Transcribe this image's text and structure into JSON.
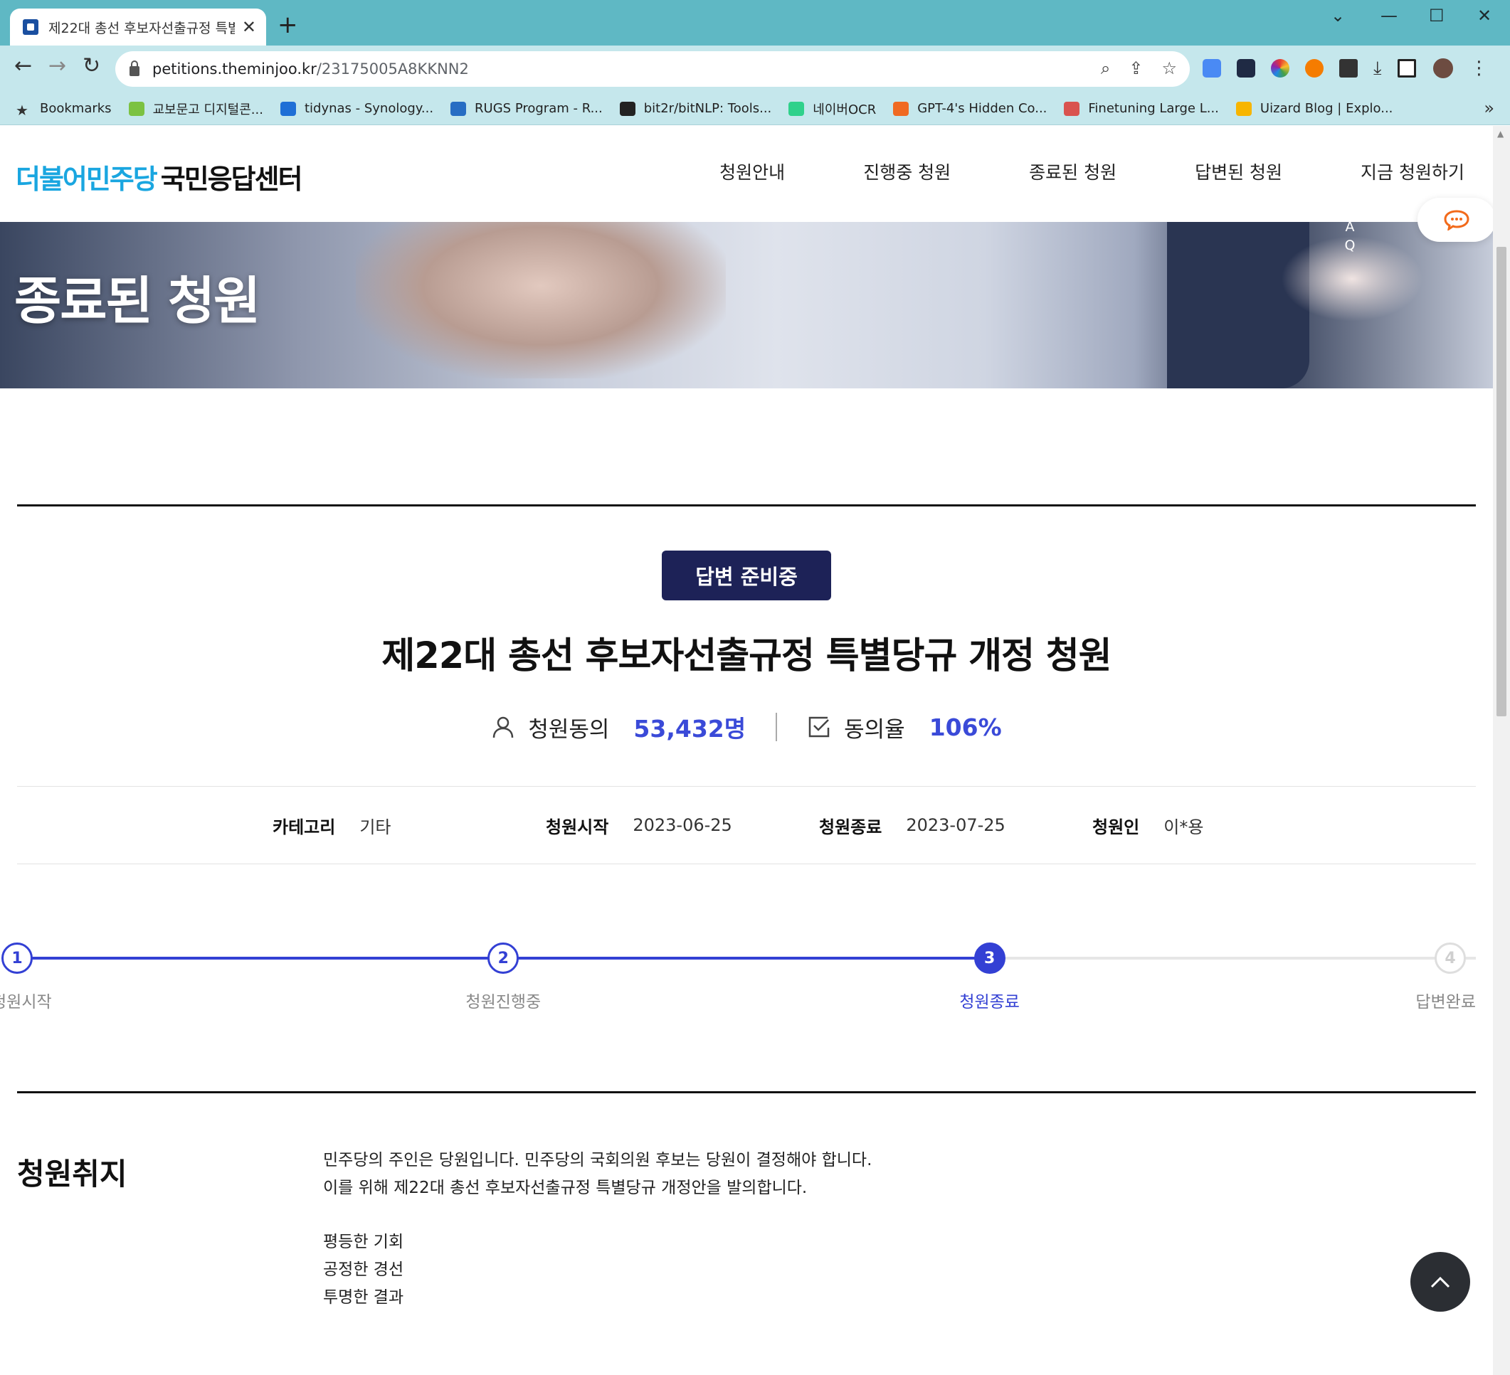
{
  "browser": {
    "tab_title": "제22대 총선 후보자선출규정 특별",
    "url_host": "petitions.theminjoo.kr",
    "url_path": "/23175005A8KKNN2",
    "bookmarks": [
      {
        "label": "Bookmarks",
        "color": "#333333",
        "icon": "star-icon"
      },
      {
        "label": "교보문고 디지털콘...",
        "color": "#7cc242",
        "icon": "kyobo-icon"
      },
      {
        "label": "tidynas - Synology...",
        "color": "#1f6fd6",
        "icon": "dsm-icon"
      },
      {
        "label": "RUGS Program - R...",
        "color": "#276dc3",
        "icon": "r-icon"
      },
      {
        "label": "bit2r/bitNLP: Tools...",
        "color": "#222222",
        "icon": "github-icon"
      },
      {
        "label": "네이버OCR",
        "color": "#2fd18b",
        "icon": "naver-ocr-icon"
      },
      {
        "label": "GPT-4's Hidden Co...",
        "color": "#f06a22",
        "icon": "bookmark-ribbon-icon"
      },
      {
        "label": "Finetuning Large L...",
        "color": "#d9534f",
        "icon": "page-icon"
      },
      {
        "label": "Uizard Blog | Explo...",
        "color": "#f7b500",
        "icon": "uizard-icon"
      }
    ]
  },
  "site": {
    "logo_blue": "더불어민주당",
    "logo_black": "국민응답센터",
    "nav": [
      "청원안내",
      "진행중 청원",
      "종료된 청원",
      "답변된 청원",
      "지금 청원하기"
    ],
    "hero_title": "종료된 청원",
    "faq_a": "A",
    "faq_q": "Q"
  },
  "petition": {
    "status": "답변 준비중",
    "title": "제22대 총선 후보자선출규정 특별당규 개정 청원",
    "agree_label": "청원동의",
    "agree_count": "53,432명",
    "rate_label": "동의율",
    "rate_value": "106%",
    "info": {
      "category_label": "카테고리",
      "category": "기타",
      "start_label": "청원시작",
      "start": "2023-06-25",
      "end_label": "청원종료",
      "end": "2023-07-25",
      "author_label": "청원인",
      "author": "이*용"
    },
    "steps": [
      {
        "num": "1",
        "label": "청원시작",
        "state": "done"
      },
      {
        "num": "2",
        "label": "청원진행중",
        "state": "done"
      },
      {
        "num": "3",
        "label": "청원종료",
        "state": "current"
      },
      {
        "num": "4",
        "label": "답변완료",
        "state": "todo"
      }
    ],
    "progress_fraction": 0.667,
    "section_title": "청원취지",
    "body_lines": [
      "민주당의 주인은 당원입니다. 민주당의 국회의원 후보는 당원이 결정해야 합니다.",
      "이를 위해 제22대 총선 후보자선출규정 특별당규 개정안을 발의합니다.",
      "",
      "평등한 기회",
      "공정한 경선",
      "투명한 결과"
    ]
  },
  "colors": {
    "accent": "#3340d4",
    "badge": "#1d2257",
    "logo_blue": "#1aa6e0",
    "chrome_tab": "#5fb8c4",
    "chrome_toolbar": "#c5e7ec"
  }
}
